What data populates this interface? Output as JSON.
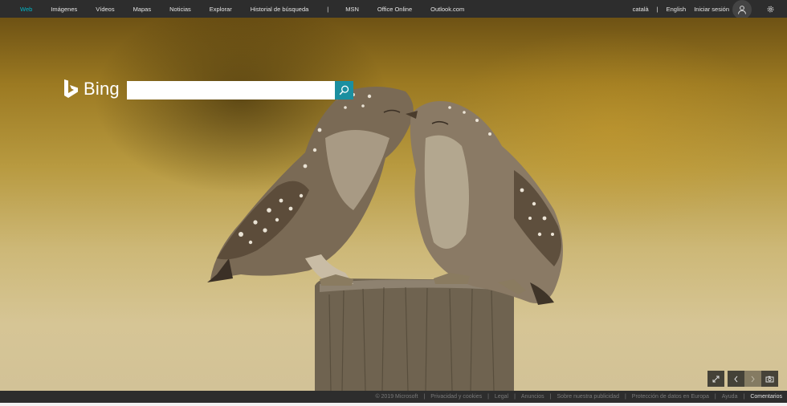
{
  "nav": {
    "items": [
      "Web",
      "Imágenes",
      "Vídeos",
      "Mapas",
      "Noticias",
      "Explorar",
      "Historial de búsqueda"
    ],
    "separator": "|",
    "items2": [
      "MSN",
      "Office Online",
      "Outlook.com"
    ],
    "lang_catala": "català",
    "divider": "|",
    "lang_english": "English",
    "signin": "Iniciar sesión"
  },
  "logo": {
    "text": "Bing"
  },
  "search": {
    "value": "",
    "placeholder": ""
  },
  "footer": {
    "copyright": "© 2019 Microsoft",
    "links": [
      "Privacidad y cookies",
      "Legal",
      "Anuncios",
      "Sobre nuestra publicidad",
      "Protección de datos en Europa",
      "Ayuda"
    ],
    "feedback": "Comentarios",
    "sep": "|"
  },
  "colors": {
    "accent": "#00b6c6",
    "search_button": "#1b8fa0",
    "bar": "#2d2d2d"
  }
}
